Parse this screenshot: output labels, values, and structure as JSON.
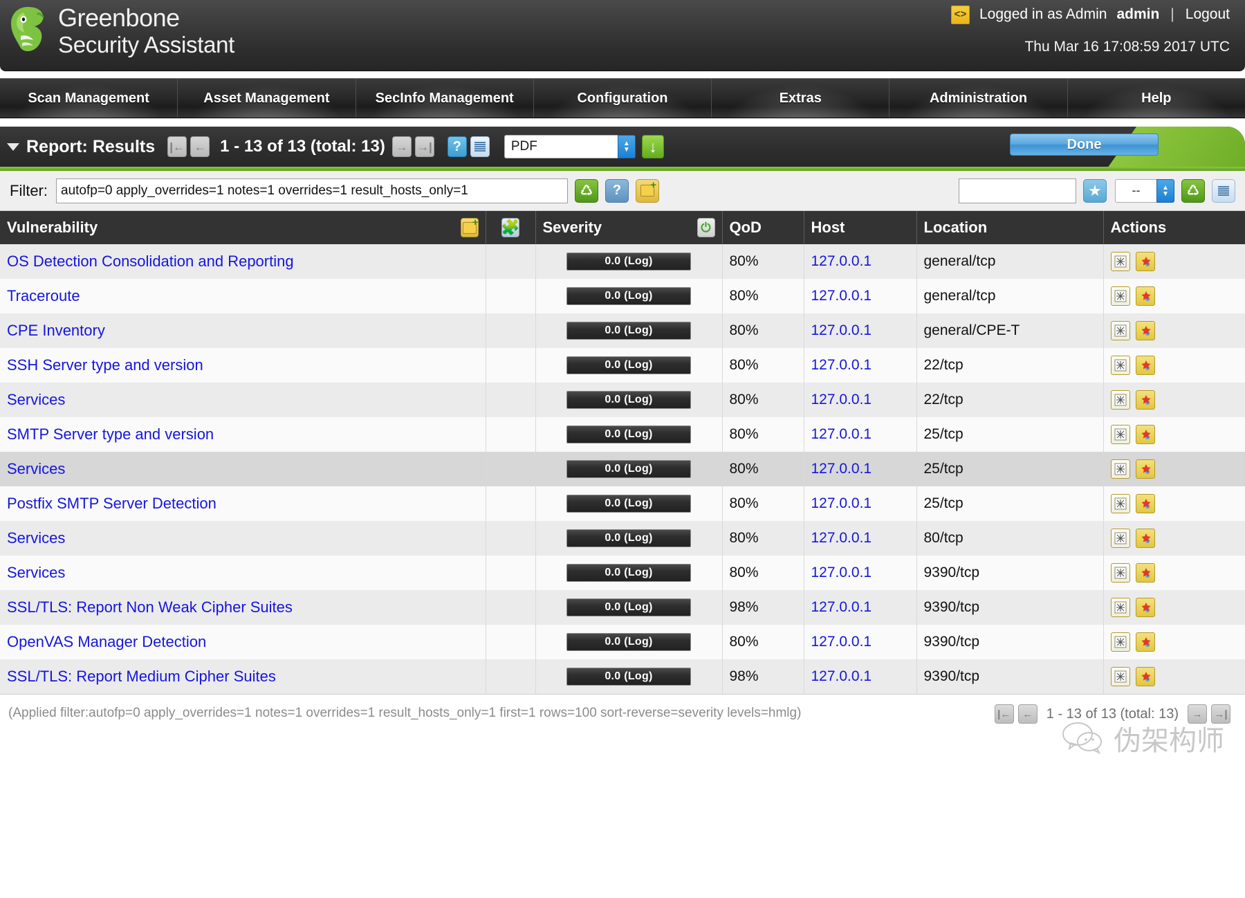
{
  "app": {
    "brand_line1": "Greenbone",
    "brand_line2": "Security Assistant",
    "logo_icon": "dragon-logo-icon"
  },
  "header": {
    "code_icon": "code-brackets-icon",
    "logged_in_text": "Logged in as Admin",
    "username": "admin",
    "separator": "|",
    "logout_label": "Logout",
    "timestamp": "Thu Mar 16 17:08:59 2017 UTC"
  },
  "nav": {
    "items": [
      {
        "label": "Scan Management"
      },
      {
        "label": "Asset Management"
      },
      {
        "label": "SecInfo Management"
      },
      {
        "label": "Configuration"
      },
      {
        "label": "Extras"
      },
      {
        "label": "Administration"
      },
      {
        "label": "Help"
      }
    ]
  },
  "section": {
    "collapse_icon": "caret-down-icon",
    "title": "Report: Results",
    "first_icon": "first-page-icon",
    "prev_icon": "previous-page-icon",
    "pager_text": "1 - 13 of 13 (total: 13)",
    "next_icon": "next-page-icon",
    "last_icon": "last-page-icon",
    "help_icon": "help-icon",
    "list_icon": "list-view-icon",
    "export_format": "PDF",
    "export_format_options": [
      "PDF"
    ],
    "download_icon": "download-icon",
    "done_label": "Done"
  },
  "filter": {
    "label": "Filter:",
    "value": "autofp=0 apply_overrides=1 notes=1 overrides=1 result_hosts_only=1",
    "refresh_icon": "refresh-icon",
    "help_icon": "help-icon",
    "new_filter_icon": "new-filter-folder-icon",
    "name_value": "",
    "name_placeholder": "",
    "favorite_icon": "star-favorite-icon",
    "saved_filter_value": "--",
    "saved_filter_options": [
      "--"
    ],
    "reload_icon": "reload-icon",
    "list_icon": "list-view-icon"
  },
  "table": {
    "columns": [
      {
        "label": "Vulnerability",
        "icon": "new-note-folder-icon"
      },
      {
        "label": "",
        "icon": "puzzle-piece-icon"
      },
      {
        "label": "Severity",
        "icon": "power-severity-icon"
      },
      {
        "label": "QoD",
        "icon": ""
      },
      {
        "label": "Host",
        "icon": ""
      },
      {
        "label": "Location",
        "icon": ""
      },
      {
        "label": "Actions",
        "icon": ""
      }
    ],
    "rows": [
      {
        "vulnerability": "OS Detection Consolidation and Reporting",
        "severity": "0.0 (Log)",
        "qod": "80%",
        "host": "127.0.0.1",
        "location": "general/tcp",
        "actions": [
          "note-action-icon",
          "override-action-icon"
        ],
        "highlight": false
      },
      {
        "vulnerability": "Traceroute",
        "severity": "0.0 (Log)",
        "qod": "80%",
        "host": "127.0.0.1",
        "location": "general/tcp",
        "actions": [
          "note-action-icon",
          "override-action-icon"
        ],
        "highlight": false
      },
      {
        "vulnerability": "CPE Inventory",
        "severity": "0.0 (Log)",
        "qod": "80%",
        "host": "127.0.0.1",
        "location": "general/CPE-T",
        "actions": [
          "note-action-icon",
          "override-action-icon"
        ],
        "highlight": false
      },
      {
        "vulnerability": "SSH Server type and version",
        "severity": "0.0 (Log)",
        "qod": "80%",
        "host": "127.0.0.1",
        "location": "22/tcp",
        "actions": [
          "note-action-icon",
          "override-action-icon"
        ],
        "highlight": false
      },
      {
        "vulnerability": "Services",
        "severity": "0.0 (Log)",
        "qod": "80%",
        "host": "127.0.0.1",
        "location": "22/tcp",
        "actions": [
          "note-action-icon",
          "override-action-icon"
        ],
        "highlight": false
      },
      {
        "vulnerability": "SMTP Server type and version",
        "severity": "0.0 (Log)",
        "qod": "80%",
        "host": "127.0.0.1",
        "location": "25/tcp",
        "actions": [
          "note-action-icon",
          "override-action-icon"
        ],
        "highlight": false
      },
      {
        "vulnerability": "Services",
        "severity": "0.0 (Log)",
        "qod": "80%",
        "host": "127.0.0.1",
        "location": "25/tcp",
        "actions": [
          "note-action-icon",
          "override-action-icon"
        ],
        "highlight": true
      },
      {
        "vulnerability": "Postfix SMTP Server Detection",
        "severity": "0.0 (Log)",
        "qod": "80%",
        "host": "127.0.0.1",
        "location": "25/tcp",
        "actions": [
          "note-action-icon",
          "override-action-icon"
        ],
        "highlight": false
      },
      {
        "vulnerability": "Services",
        "severity": "0.0 (Log)",
        "qod": "80%",
        "host": "127.0.0.1",
        "location": "80/tcp",
        "actions": [
          "note-action-icon",
          "override-action-icon"
        ],
        "highlight": false
      },
      {
        "vulnerability": "Services",
        "severity": "0.0 (Log)",
        "qod": "80%",
        "host": "127.0.0.1",
        "location": "9390/tcp",
        "actions": [
          "note-action-icon",
          "override-action-icon"
        ],
        "highlight": false
      },
      {
        "vulnerability": "SSL/TLS: Report Non Weak Cipher Suites",
        "severity": "0.0 (Log)",
        "qod": "98%",
        "host": "127.0.0.1",
        "location": "9390/tcp",
        "actions": [
          "note-action-icon",
          "override-action-icon"
        ],
        "highlight": false
      },
      {
        "vulnerability": "OpenVAS Manager Detection",
        "severity": "0.0 (Log)",
        "qod": "80%",
        "host": "127.0.0.1",
        "location": "9390/tcp",
        "actions": [
          "note-action-icon",
          "override-action-icon"
        ],
        "highlight": false
      },
      {
        "vulnerability": "SSL/TLS: Report Medium Cipher Suites",
        "severity": "0.0 (Log)",
        "qod": "98%",
        "host": "127.0.0.1",
        "location": "9390/tcp",
        "actions": [
          "note-action-icon",
          "override-action-icon"
        ],
        "highlight": false
      }
    ]
  },
  "footer": {
    "applied_filter": "(Applied filter:autofp=0 apply_overrides=1 notes=1 overrides=1 result_hosts_only=1 first=1 rows=100 sort-reverse=severity levels=hmlg)",
    "pager_text": "1 - 13 of 13 (total: 13)",
    "first_icon": "first-page-icon",
    "prev_icon": "previous-page-icon",
    "next_icon": "next-page-icon",
    "last_icon": "last-page-icon",
    "watermark_text": "伪架构师",
    "watermark_icon": "wechat-icon"
  },
  "colors": {
    "accent_green": "#8ec63f",
    "link_blue": "#1515e0",
    "header_dark": "#333333",
    "button_blue": "#3d93d4"
  }
}
